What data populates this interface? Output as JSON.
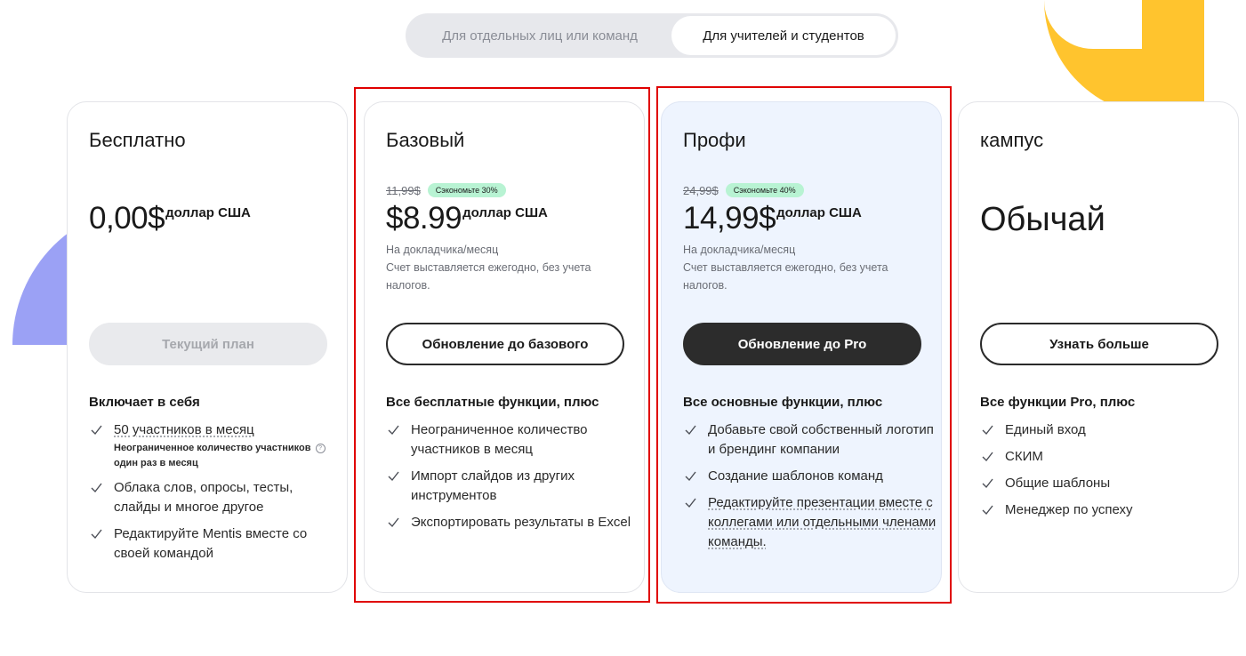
{
  "toggle": {
    "options": [
      "Для отдельных лиц или команд",
      "Для учителей и студентов"
    ],
    "active_index": 1
  },
  "plans": [
    {
      "title": "Бесплатно",
      "price": "0,00$",
      "currency": "доллар США",
      "cta": "Текущий план",
      "cta_state": "disabled",
      "features_head": "Включает в себя",
      "features": [
        {
          "text": "50 участников в месяц",
          "subnote": "Неограниченное количество участников один раз в месяц"
        },
        {
          "text": "Облака слов, опросы, тесты, слайды и многое другое"
        },
        {
          "text": "Редактируйте Mentis вместе со своей командой"
        }
      ]
    },
    {
      "title": "Базовый",
      "old_price": "11,99$",
      "badge": "Сэкономьте 30%",
      "price": "$8.99",
      "currency": "доллар США",
      "note_line1": "На докладчика/месяц",
      "note_line2": "Счет выставляется ежегодно, без учета налогов.",
      "cta": "Обновление до базового",
      "cta_state": "outline",
      "features_head": "Все бесплатные функции, плюс",
      "features": [
        {
          "text": "Неограниченное количество участников в месяц"
        },
        {
          "text": "Импорт слайдов из других инструментов"
        },
        {
          "text": "Экспортировать результаты в Excel"
        }
      ]
    },
    {
      "title": "Профи",
      "old_price": "24,99$",
      "badge": "Сэкономьте 40%",
      "price": "14,99$",
      "currency": "доллар США",
      "note_line1": "На докладчика/месяц",
      "note_line2": "Счет выставляется ежегодно, без учета налогов.",
      "cta": "Обновление до Pro",
      "cta_state": "dark",
      "features_head": "Все основные функции, плюс",
      "features": [
        {
          "text": "Добавьте свой собственный логотип и брендинг компании"
        },
        {
          "text": "Создание шаблонов команд"
        },
        {
          "text": "Редактируйте презентации вместе с коллегами или отдельными членами команды."
        }
      ]
    },
    {
      "title": "кампус",
      "price": "Обычай",
      "cta": "Узнать больше",
      "cta_state": "outline",
      "features_head": "Все функции Pro, плюс",
      "features": [
        {
          "text": "Единый вход"
        },
        {
          "text": "СКИМ"
        },
        {
          "text": "Общие шаблоны"
        },
        {
          "text": "Менеджер по успеху"
        }
      ]
    }
  ],
  "colors": {
    "accent_dark": "#2c2c2c",
    "badge_green": "#b8f3d3",
    "pro_card_bg": "#eef4fe",
    "highlight_red": "#e00000",
    "deco_purple": "#9ba1f5",
    "deco_yellow": "#ffc42e"
  }
}
